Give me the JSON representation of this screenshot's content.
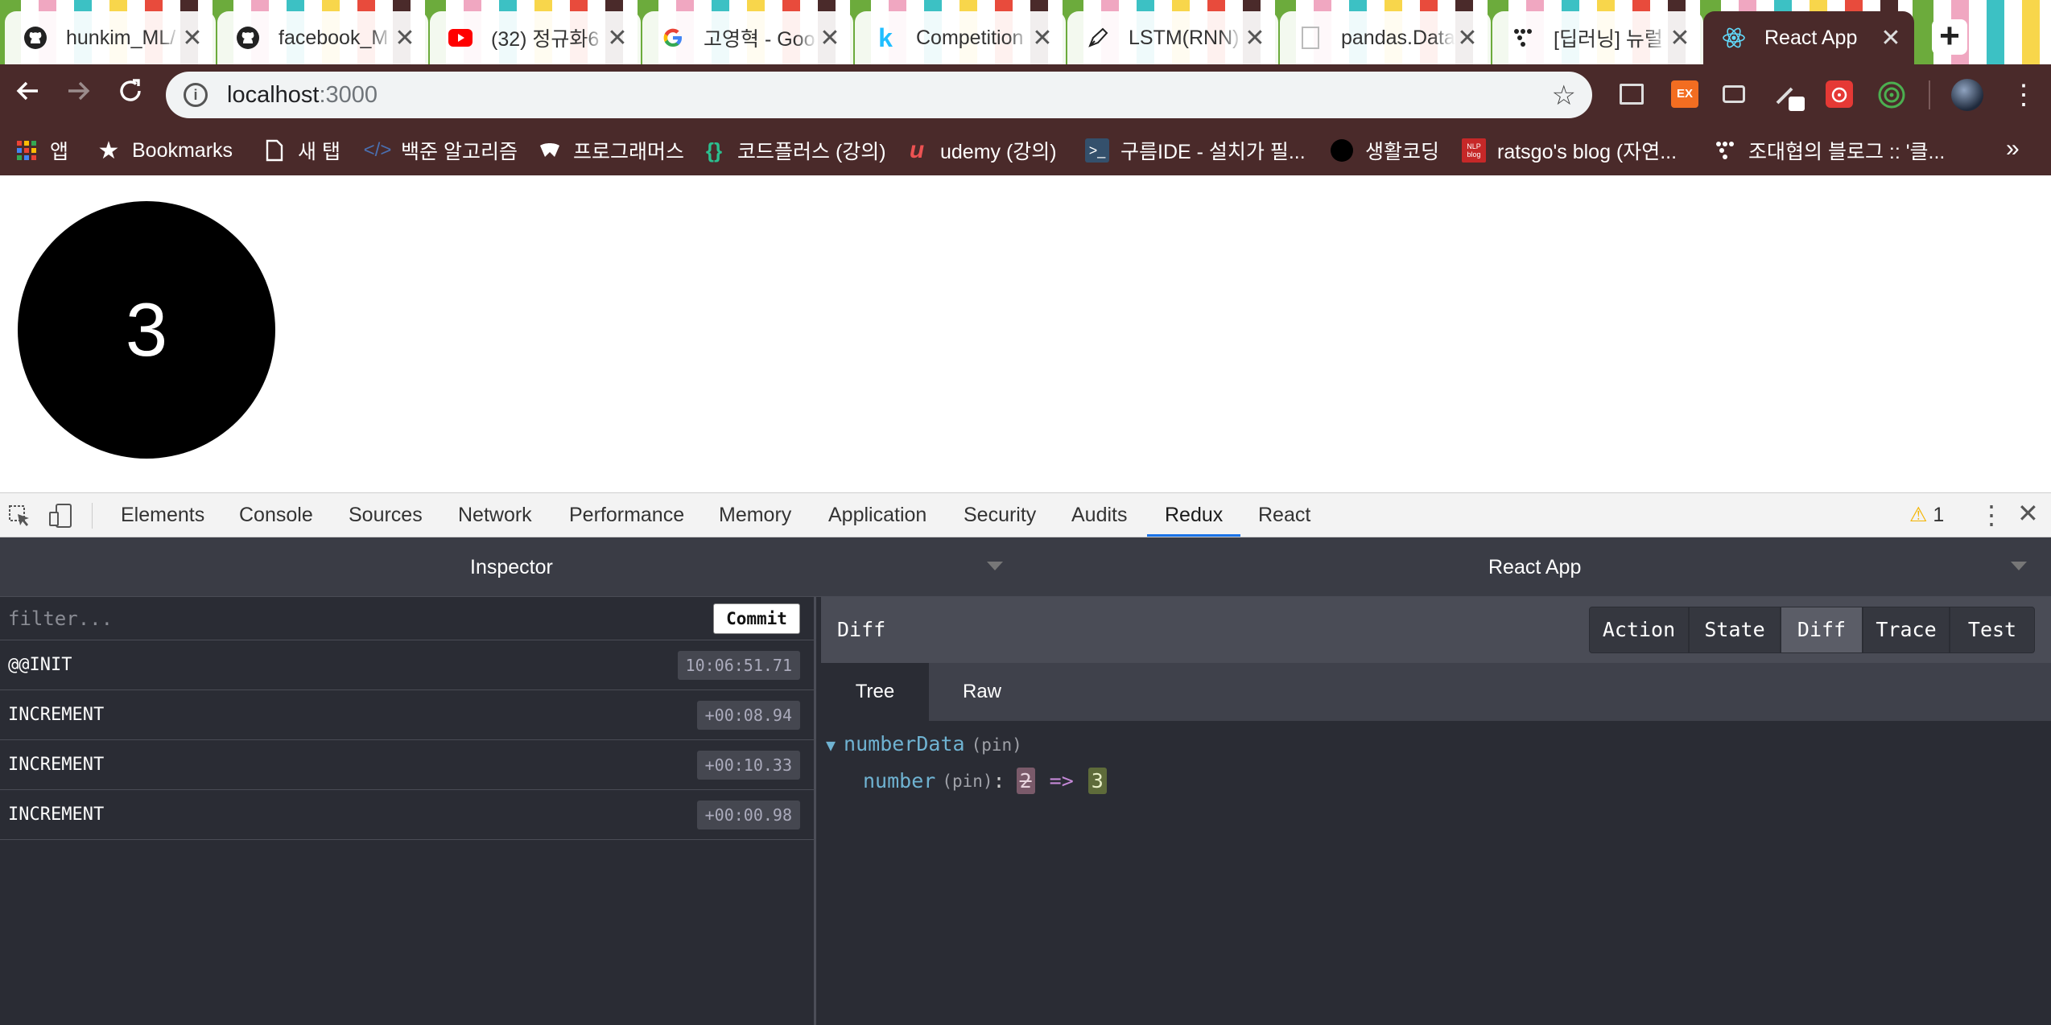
{
  "browser": {
    "tabs": [
      {
        "title": "hunkim_ML/",
        "icon": "github-icon"
      },
      {
        "title": "facebook_M",
        "icon": "github-icon"
      },
      {
        "title": "(32) 정규화6",
        "icon": "youtube-icon"
      },
      {
        "title": "고영혁 - Goo",
        "icon": "google-icon"
      },
      {
        "title": "Competition",
        "icon": "kaggle-icon"
      },
      {
        "title": "LSTM(RNN)",
        "icon": "pen-icon"
      },
      {
        "title": "pandas.Data",
        "icon": "document-icon"
      },
      {
        "title": "[딥러닝] 뉴럴",
        "icon": "dots-icon"
      },
      {
        "title": "React App",
        "icon": "react-icon",
        "active": true
      }
    ],
    "close_glyph": "✕",
    "new_tab_glyph": "+",
    "url_host": "localhost",
    "url_port": ":3000"
  },
  "bookmarks": [
    {
      "label": "앱",
      "icon": "apps-grid-icon"
    },
    {
      "label": "Bookmarks",
      "icon": "star-icon"
    },
    {
      "label": "새 탭",
      "icon": "page-icon"
    },
    {
      "label": "백준 알고리즘",
      "icon": "code-icon"
    },
    {
      "label": "프로그래머스",
      "icon": "programmers-icon"
    },
    {
      "label": "코드플러스 (강의)",
      "icon": "braces-icon"
    },
    {
      "label": "udemy (강의)",
      "icon": "udemy-icon"
    },
    {
      "label": "구름IDE - 설치가 필...",
      "icon": "terminal-icon"
    },
    {
      "label": "생활코딩",
      "icon": "circle-icon"
    },
    {
      "label": "ratsgo's blog (자연...",
      "icon": "nlp-blog-icon"
    },
    {
      "label": "조대협의 블로그 :: '클...",
      "icon": "dots-icon"
    }
  ],
  "page": {
    "counter_value": "3"
  },
  "devtools": {
    "tabs": [
      "Elements",
      "Console",
      "Sources",
      "Network",
      "Performance",
      "Memory",
      "Application",
      "Security",
      "Audits",
      "Redux",
      "React"
    ],
    "active_tab": "Redux",
    "warning_count": "1",
    "warning_glyph": "⚠"
  },
  "redux": {
    "left_title": "Inspector",
    "right_title": "React App",
    "filter_placeholder": "filter...",
    "commit_label": "Commit",
    "actions": [
      {
        "name": "@@INIT",
        "time": "10:06:51.71"
      },
      {
        "name": "INCREMENT",
        "time": "+00:08.94"
      },
      {
        "name": "INCREMENT",
        "time": "+00:10.33"
      },
      {
        "name": "INCREMENT",
        "time": "+00:00.98"
      }
    ],
    "panel_label": "Diff",
    "monitor_buttons": [
      "Action",
      "State",
      "Diff",
      "Trace",
      "Test"
    ],
    "active_monitor": "Diff",
    "subtabs": [
      "Tree",
      "Raw"
    ],
    "active_subtab": "Tree",
    "diff": {
      "root_key": "numberData",
      "root_pin": "(pin)",
      "leaf_key": "number",
      "leaf_pin": "(pin)",
      "colon": ":",
      "old_value": "2",
      "arrow": "=>",
      "new_value": "3"
    }
  },
  "colors": {
    "theme": "#4a2a2a",
    "redux_bg": "#2a2c34",
    "active_devtools_underline": "#1a73e8",
    "tree_key": "#6fb3d2"
  }
}
